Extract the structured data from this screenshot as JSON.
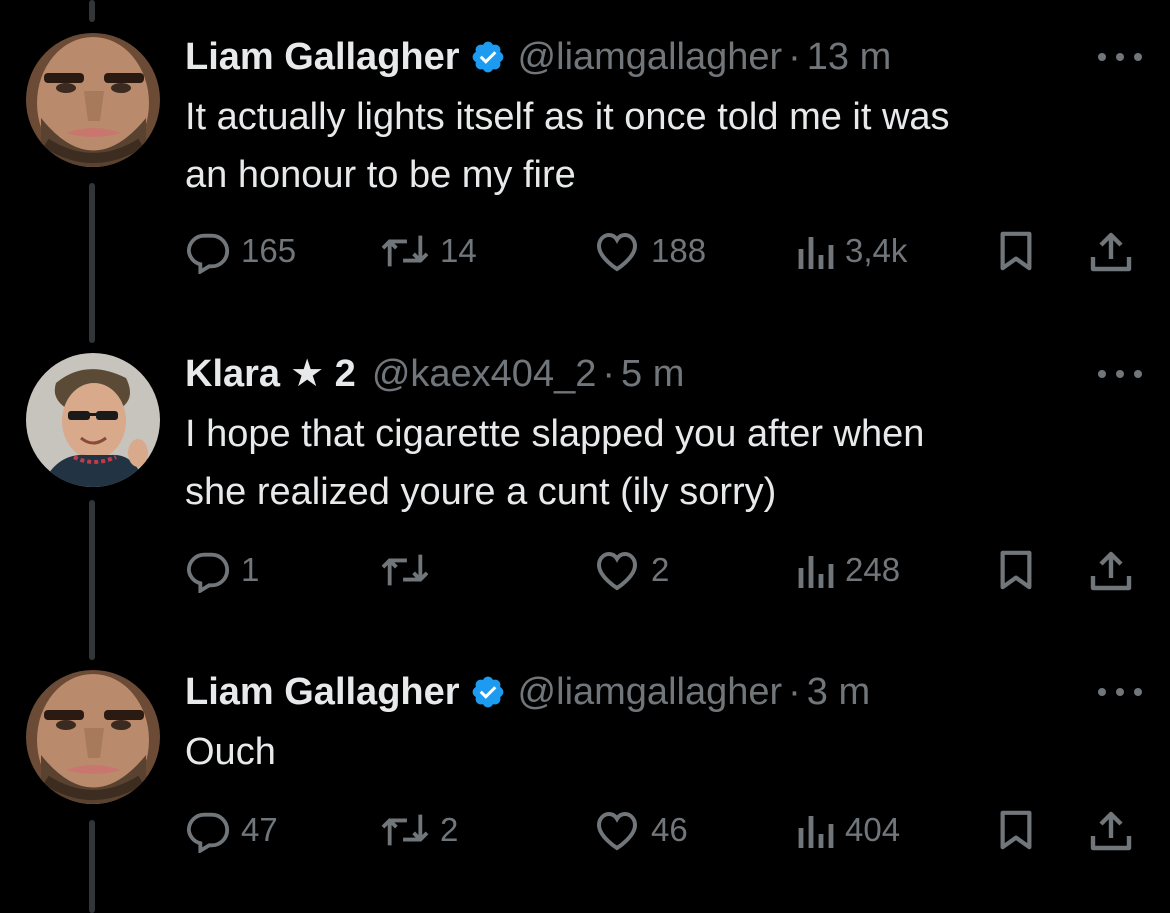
{
  "colors": {
    "background": "#000000",
    "text": "#e7e9ea",
    "muted": "#71767b",
    "verified": "#1d9bf0",
    "thread_line": "#333639"
  },
  "tweets": [
    {
      "name": "Liam Gallagher",
      "verified": true,
      "handle": "@liamgallagher",
      "separator": "·",
      "time": "13 m",
      "text_lines": [
        "It actually lights itself as it once told me it was",
        "an honour to be my fire"
      ],
      "replies": "165",
      "retweets": "14",
      "likes": "188",
      "views": "3,4k",
      "avatar": "liam-gallagher-avatar"
    },
    {
      "name": "Klara",
      "name_suffix": "★ 2",
      "verified": false,
      "handle": "@kaex404_2",
      "separator": "·",
      "time": "5 m",
      "text_lines": [
        "I hope that cigarette slapped you after when",
        "she realized youre a cunt (ily sorry)"
      ],
      "replies": "1",
      "retweets": "",
      "likes": "2",
      "views": "248",
      "avatar": "klara-avatar"
    },
    {
      "name": "Liam Gallagher",
      "verified": true,
      "handle": "@liamgallagher",
      "separator": "·",
      "time": "3 m",
      "text_lines": [
        "Ouch"
      ],
      "replies": "47",
      "retweets": "2",
      "likes": "46",
      "views": "404",
      "avatar": "liam-gallagher-avatar"
    }
  ],
  "icons": {
    "reply": "reply-icon",
    "retweet": "retweet-icon",
    "like": "heart-icon",
    "views": "views-icon",
    "bookmark": "bookmark-icon",
    "share": "share-icon",
    "more": "more-icon",
    "verified": "verified-badge-icon"
  }
}
